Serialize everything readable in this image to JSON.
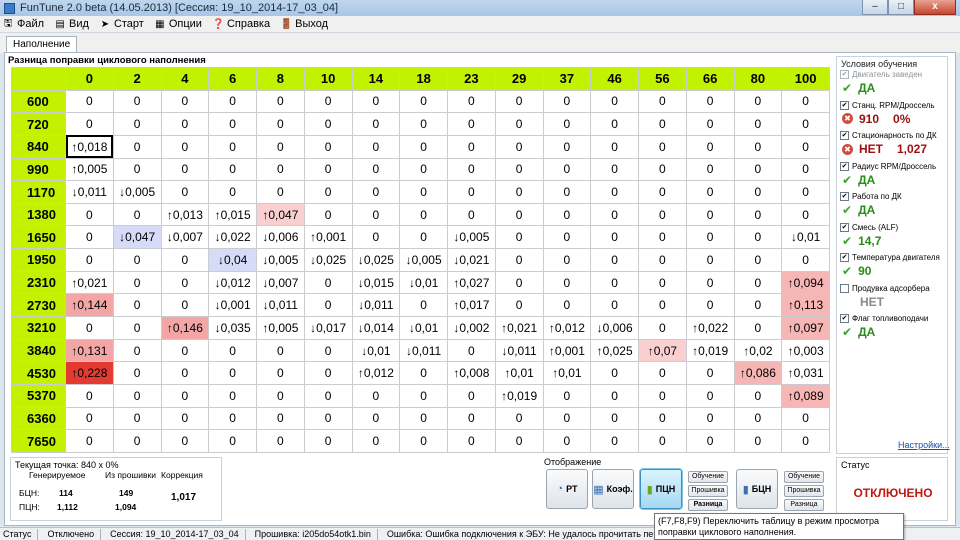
{
  "window": {
    "title": "FunTune 2.0 beta (14.05.2013) [Сессия: 19_10_2014-17_03_04]",
    "min": "–",
    "max": "□",
    "close": "x"
  },
  "menu": [
    {
      "label": "Файл",
      "icon": "file-icon",
      "glyph": "🖫"
    },
    {
      "label": "Вид",
      "icon": "view-icon",
      "glyph": "▤"
    },
    {
      "label": "Старт",
      "icon": "start-icon",
      "glyph": "➤"
    },
    {
      "label": "Опции",
      "icon": "options-icon",
      "glyph": "▦"
    },
    {
      "label": "Справка",
      "icon": "help-icon",
      "glyph": "❓"
    },
    {
      "label": "Выход",
      "icon": "exit-icon",
      "glyph": "🚪"
    }
  ],
  "tab": {
    "label": "Наполнение"
  },
  "table": {
    "title": "Разница поправки циклового наполнения",
    "columns": [
      "0",
      "2",
      "4",
      "6",
      "8",
      "10",
      "14",
      "18",
      "23",
      "29",
      "37",
      "46",
      "56",
      "66",
      "80",
      "100"
    ],
    "rows": [
      {
        "rpm": "600",
        "cells": [
          "0",
          "0",
          "0",
          "0",
          "0",
          "0",
          "0",
          "0",
          "0",
          "0",
          "0",
          "0",
          "0",
          "0",
          "0",
          "0"
        ]
      },
      {
        "rpm": "720",
        "cells": [
          "0",
          "0",
          "0",
          "0",
          "0",
          "0",
          "0",
          "0",
          "0",
          "0",
          "0",
          "0",
          "0",
          "0",
          "0",
          "0"
        ]
      },
      {
        "rpm": "840",
        "cells": [
          "↑0,018",
          "0",
          "0",
          "0",
          "0",
          "0",
          "0",
          "0",
          "0",
          "0",
          "0",
          "0",
          "0",
          "0",
          "0",
          "0"
        ]
      },
      {
        "rpm": "990",
        "cells": [
          "↑0,005",
          "0",
          "0",
          "0",
          "0",
          "0",
          "0",
          "0",
          "0",
          "0",
          "0",
          "0",
          "0",
          "0",
          "0",
          "0"
        ]
      },
      {
        "rpm": "1170",
        "cells": [
          "↓0,011",
          "↓0,005",
          "0",
          "0",
          "0",
          "0",
          "0",
          "0",
          "0",
          "0",
          "0",
          "0",
          "0",
          "0",
          "0",
          "0"
        ]
      },
      {
        "rpm": "1380",
        "cells": [
          "0",
          "0",
          "↑0,013",
          "↑0,015",
          "↑0,047",
          "0",
          "0",
          "0",
          "0",
          "0",
          "0",
          "0",
          "0",
          "0",
          "0",
          "0"
        ]
      },
      {
        "rpm": "1650",
        "cells": [
          "0",
          "↓0,047",
          "↓0,007",
          "↓0,022",
          "↓0,006",
          "↑0,001",
          "0",
          "0",
          "↓0,005",
          "0",
          "0",
          "0",
          "0",
          "0",
          "0",
          "↓0,01"
        ]
      },
      {
        "rpm": "1950",
        "cells": [
          "0",
          "0",
          "0",
          "↓0,04",
          "↓0,005",
          "↓0,025",
          "↓0,025",
          "↓0,005",
          "↓0,021",
          "0",
          "0",
          "0",
          "0",
          "0",
          "0",
          "0"
        ]
      },
      {
        "rpm": "2310",
        "cells": [
          "↑0,021",
          "0",
          "0",
          "↓0,012",
          "↓0,007",
          "0",
          "↓0,015",
          "↓0,01",
          "↑0,027",
          "0",
          "0",
          "0",
          "0",
          "0",
          "0",
          "↑0,094"
        ]
      },
      {
        "rpm": "2730",
        "cells": [
          "↑0,144",
          "0",
          "0",
          "↓0,001",
          "↓0,011",
          "0",
          "↓0,011",
          "0",
          "↑0,017",
          "0",
          "0",
          "0",
          "0",
          "0",
          "0",
          "↑0,113"
        ]
      },
      {
        "rpm": "3210",
        "cells": [
          "0",
          "0",
          "↑0,146",
          "↓0,035",
          "↑0,005",
          "↓0,017",
          "↓0,014",
          "↓0,01",
          "↓0,002",
          "↑0,021",
          "↑0,012",
          "↓0,006",
          "0",
          "↑0,022",
          "0",
          "↑0,097"
        ]
      },
      {
        "rpm": "3840",
        "cells": [
          "↑0,131",
          "0",
          "0",
          "0",
          "0",
          "0",
          "↓0,01",
          "↓0,011",
          "0",
          "↓0,011",
          "↑0,001",
          "↑0,025",
          "↑0,07",
          "↑0,019",
          "↑0,02",
          "↑0,003"
        ]
      },
      {
        "rpm": "4530",
        "cells": [
          "↑0,228",
          "0",
          "0",
          "0",
          "0",
          "0",
          "↑0,012",
          "0",
          "↑0,008",
          "↑0,01",
          "↑0,01",
          "0",
          "0",
          "0",
          "↑0,086",
          "↑0,031"
        ]
      },
      {
        "rpm": "5370",
        "cells": [
          "0",
          "0",
          "0",
          "0",
          "0",
          "0",
          "0",
          "0",
          "0",
          "↑0,019",
          "0",
          "0",
          "0",
          "0",
          "0",
          "↑0,089"
        ]
      },
      {
        "rpm": "6360",
        "cells": [
          "0",
          "0",
          "0",
          "0",
          "0",
          "0",
          "0",
          "0",
          "0",
          "0",
          "0",
          "0",
          "0",
          "0",
          "0",
          "0"
        ]
      },
      {
        "rpm": "7650",
        "cells": [
          "0",
          "0",
          "0",
          "0",
          "0",
          "0",
          "0",
          "0",
          "0",
          "0",
          "0",
          "0",
          "0",
          "0",
          "0",
          "0"
        ]
      }
    ],
    "cell_colors": {
      "2,0": "#ffffff",
      "5,4": "#f9cfcf",
      "6,1": "#d6dcf7",
      "7,3": "#d6dcf7",
      "8,15": "#f6b6b6",
      "9,0": "#f4a6a6",
      "9,15": "#f6b6b6",
      "10,2": "#f4a6a6",
      "10,15": "#f6b6b6",
      "11,0": "#f4a6a6",
      "11,12": "#f9cfcf",
      "12,0": "#e43a32",
      "12,14": "#f6b6b6",
      "13,15": "#f6b6b6"
    },
    "selected_cell": "2,0"
  },
  "conditions": {
    "title": "Условия обучения",
    "items": [
      {
        "label": "Двигатель заведен",
        "checked": true,
        "disabled": true,
        "status": "ok",
        "value": "ДА",
        "value2": ""
      },
      {
        "label": "Станц. RPM/Дроссель",
        "checked": true,
        "disabled": false,
        "status": "bad",
        "value": "910",
        "value2": "0%"
      },
      {
        "label": "Стационарность по ДК",
        "checked": true,
        "disabled": false,
        "status": "bad",
        "value": "НЕТ",
        "value2": "1,027"
      },
      {
        "label": "Радиус RPM/Дроссель",
        "checked": true,
        "disabled": false,
        "status": "ok",
        "value": "ДА",
        "value2": ""
      },
      {
        "label": "Работа по ДК",
        "checked": true,
        "disabled": false,
        "status": "ok",
        "value": "ДА",
        "value2": ""
      },
      {
        "label": "Смесь (ALF)",
        "checked": true,
        "disabled": false,
        "status": "ok",
        "value": "14,7",
        "value2": ""
      },
      {
        "label": "Температура двигателя",
        "checked": true,
        "disabled": false,
        "status": "ok",
        "value": "90",
        "value2": ""
      },
      {
        "label": "Продувка адсорбера",
        "checked": false,
        "disabled": false,
        "status": "none",
        "value": "НЕТ",
        "value2": ""
      },
      {
        "label": "Флаг топливоподачи",
        "checked": true,
        "disabled": false,
        "status": "ok",
        "value": "ДА",
        "value2": ""
      }
    ],
    "settings_link": "Настройки..."
  },
  "current_point": {
    "title": "Текущая точка: 840 x 0%",
    "col_generated": "Генерируемое",
    "col_firmware": "Из прошивки",
    "col_correction": "Коррекция",
    "rows": [
      {
        "label": "БЦН:",
        "generated": "114",
        "firmware": "149"
      },
      {
        "label": "ПЦН:",
        "generated": "1,112",
        "firmware": "1,094"
      }
    ],
    "correction": "1,017"
  },
  "display": {
    "title": "Отображение",
    "btn_rt": "РТ",
    "btn_koef": "Коэф.",
    "btn_pcn": "ПЦН",
    "btn_bcn": "БЦН",
    "sub_left": [
      "Обучение",
      "Прошивка",
      "Разница"
    ],
    "sub_right": [
      "Обучение",
      "Прошивка",
      "Разница"
    ]
  },
  "status": {
    "title": "Статус",
    "value": "ОТКЛЮЧЕНО"
  },
  "tooltip": "(F7,F8,F9) Переключить таблицу в режим просмотра поправки циклового наполнения.",
  "statusbar": {
    "status_label": "Статус",
    "status_value": "Отключено",
    "session": "Сессия:  19_10_2014-17_03_04",
    "firmware": "Прошивка:  i205do54otk1.bin",
    "error": "Ошибка: Ошибка подключения к ЭБУ: Не удалось прочитать первые"
  }
}
